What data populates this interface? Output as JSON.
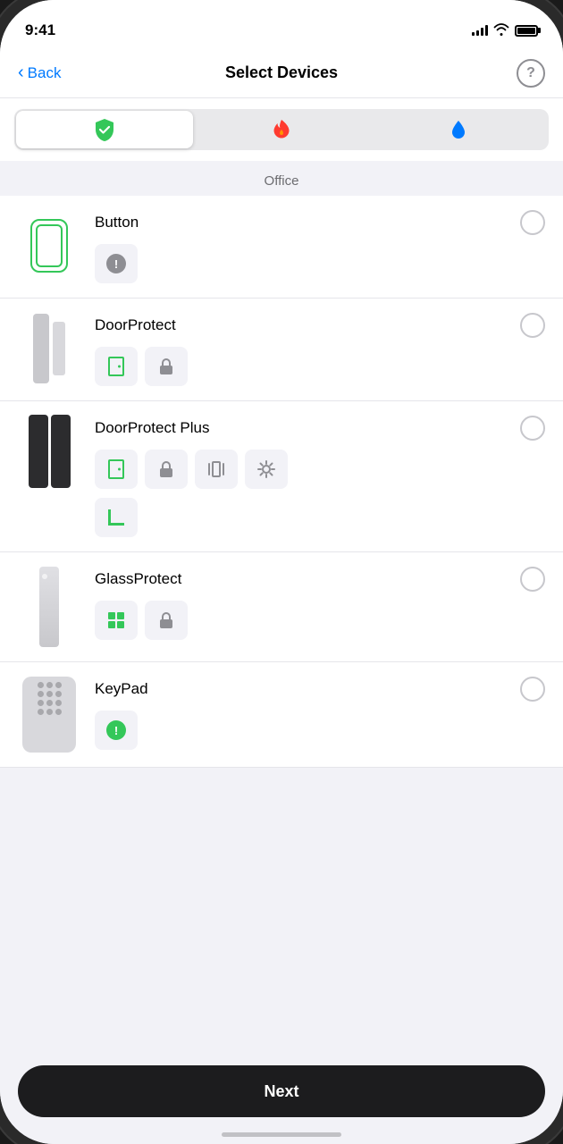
{
  "status": {
    "time": "9:41",
    "signal_bars": [
      4,
      6,
      8,
      10,
      12
    ],
    "battery_full": true
  },
  "nav": {
    "back_label": "Back",
    "title": "Select Devices",
    "help_label": "?"
  },
  "segment": {
    "tabs": [
      {
        "id": "security",
        "icon": "🛡️",
        "active": true
      },
      {
        "id": "fire",
        "icon": "🔥",
        "active": false
      },
      {
        "id": "water",
        "icon": "💧",
        "active": false
      }
    ]
  },
  "section": {
    "label": "Office"
  },
  "devices": [
    {
      "name": "Button",
      "type": "button",
      "tags": [
        "alert"
      ]
    },
    {
      "name": "DoorProtect",
      "type": "door",
      "tags": [
        "door",
        "lock"
      ]
    },
    {
      "name": "DoorProtect Plus",
      "type": "door-plus",
      "tags": [
        "door",
        "lock",
        "vibration",
        "sun",
        "bracket"
      ]
    },
    {
      "name": "GlassProtect",
      "type": "glass",
      "tags": [
        "grid",
        "lock"
      ]
    },
    {
      "name": "KeyPad",
      "type": "keypad",
      "tags": [
        "alert-green"
      ]
    }
  ],
  "footer": {
    "next_label": "Next"
  }
}
